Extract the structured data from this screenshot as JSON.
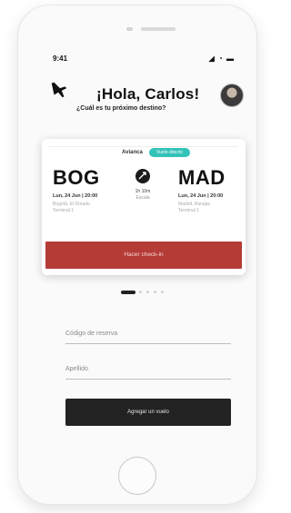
{
  "status": {
    "time": "9:41",
    "icons": "◢ ◔ ▬"
  },
  "header": {
    "greeting": "¡Hola, Carlos!",
    "subtitle": "¿Cuál es tu próximo destino?",
    "plane_icon": "airplane-icon",
    "avatar_icon": "user-avatar"
  },
  "flight_card": {
    "airline": "Avianca",
    "badge": "Vuelo directo",
    "origin": {
      "code": "BOG",
      "datetime": "Lun, 24 Jun | 20:00",
      "airport_line1": "Bogotá, El Dorado",
      "airport_line2": "Terminal 1"
    },
    "destination": {
      "code": "MAD",
      "datetime": "Lun, 24 Jun | 20:00",
      "airport_line1": "Madrid, Barajas",
      "airport_line2": "Terminal 1"
    },
    "duration": "1h 10m",
    "duration_sub": "Escala",
    "checkin_button": "Hacer check-in"
  },
  "pager": {
    "count": 5,
    "active": 0
  },
  "form": {
    "reservation_label": "Código de reserva",
    "lastname_label": "Apellido",
    "add_button": "Agregar un vuelo"
  },
  "colors": {
    "checkin_button": "#b43b36",
    "badge": "#33c2b8",
    "add_button": "#222222"
  }
}
